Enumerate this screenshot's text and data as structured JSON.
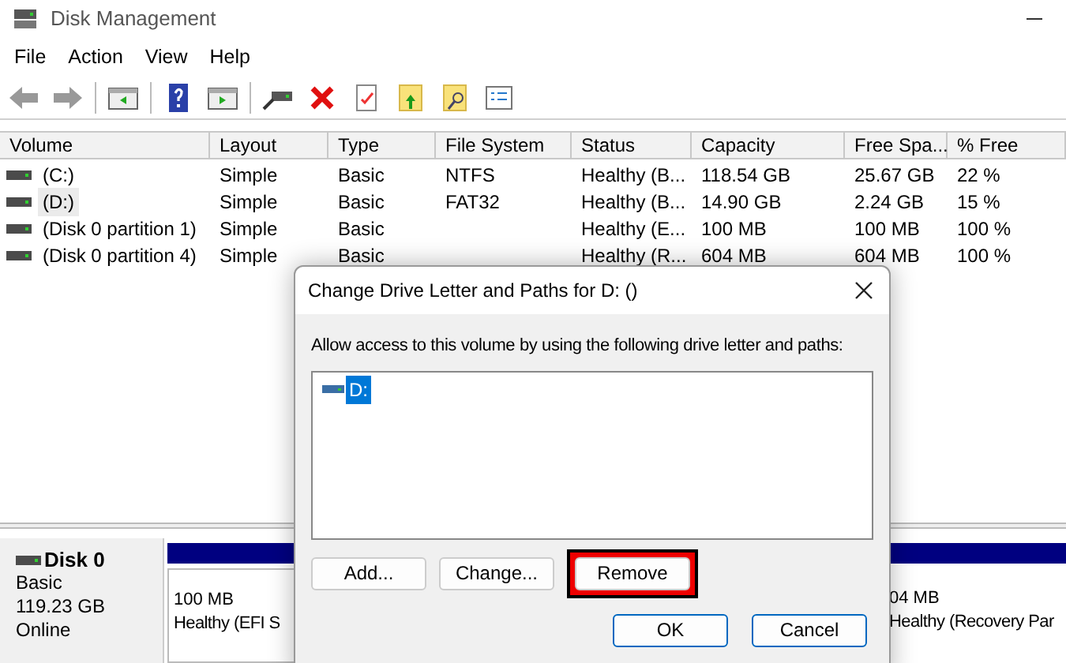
{
  "window": {
    "title": "Disk Management"
  },
  "menu": [
    "File",
    "Action",
    "View",
    "Help"
  ],
  "table": {
    "columns": [
      "Volume",
      "Layout",
      "Type",
      "File System",
      "Status",
      "Capacity",
      "Free Spa...",
      "% Free"
    ],
    "rows": [
      {
        "selected": false,
        "cells": [
          "(C:)",
          "Simple",
          "Basic",
          "NTFS",
          "Healthy (B...",
          "118.54 GB",
          "25.67 GB",
          "22 %"
        ]
      },
      {
        "selected": true,
        "cells": [
          "(D:)",
          "Simple",
          "Basic",
          "FAT32",
          "Healthy (B...",
          "14.90 GB",
          "2.24 GB",
          "15 %"
        ]
      },
      {
        "selected": false,
        "cells": [
          "(Disk 0 partition 1)",
          "Simple",
          "Basic",
          "",
          "Healthy (E...",
          "100 MB",
          "100 MB",
          "100 %"
        ]
      },
      {
        "selected": false,
        "cells": [
          "(Disk 0 partition 4)",
          "Simple",
          "Basic",
          "",
          "Healthy (R...",
          "604 MB",
          "604 MB",
          "100 %"
        ]
      }
    ]
  },
  "disk": {
    "name": "Disk 0",
    "type": "Basic",
    "size": "119.23 GB",
    "status": "Online",
    "partitions": [
      {
        "size": "100 MB",
        "status": "Healthy (EFI S"
      },
      {
        "size": "04 MB",
        "status": "Healthy (Recovery Par"
      }
    ]
  },
  "dialog": {
    "title": "Change Drive Letter and Paths for D: ()",
    "prompt": "Allow access to this volume by using the following drive letter and paths:",
    "paths": [
      {
        "label": "D:",
        "selected": true
      }
    ],
    "buttons": [
      {
        "label": "Add...",
        "highlighted": false
      },
      {
        "label": "Change...",
        "highlighted": false
      },
      {
        "label": "Remove",
        "highlighted": true
      }
    ],
    "footer_buttons": [
      {
        "label": "OK",
        "default": true
      },
      {
        "label": "Cancel",
        "default": true
      }
    ]
  }
}
